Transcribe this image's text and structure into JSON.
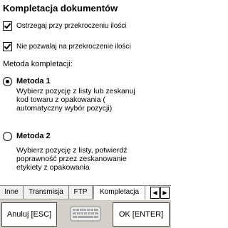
{
  "header": {
    "title": "Kompletacja dokumentów"
  },
  "options": {
    "warn_exceed": {
      "label": "Ostrzegaj przy przekroczeniu ilości",
      "checked": true
    },
    "block_exceed": {
      "label": "Nie pozwalaj na przekroczenie ilości",
      "checked": true
    }
  },
  "method": {
    "label": "Metoda kompletacji:",
    "items": [
      {
        "title": "Metoda 1",
        "desc": [
          "Wybierz pozycję z listy lub zeskanuj",
          "kod towaru z opakowania (",
          "automatyczny wybór pozycji)"
        ],
        "selected": true
      },
      {
        "title": "Metoda 2",
        "desc": [
          "Wybierz pozycję z listy, potwierdź",
          "poprawność przez zeskanowanie",
          "etykiety z opakowania"
        ],
        "selected": false
      }
    ]
  },
  "tabs": [
    {
      "label": "Inne"
    },
    {
      "label": "Transmisja"
    },
    {
      "label": "FTP"
    },
    {
      "label": "Kompletacja",
      "active": true
    }
  ],
  "tab_scroll": {
    "left_icon": "arrow-left-icon",
    "right_icon": "arrow-right-icon"
  },
  "footer": {
    "cancel_label": "Anuluj [ESC]",
    "ok_label": "OK [ENTER]",
    "keyboard_icon": "keyboard-icon"
  }
}
